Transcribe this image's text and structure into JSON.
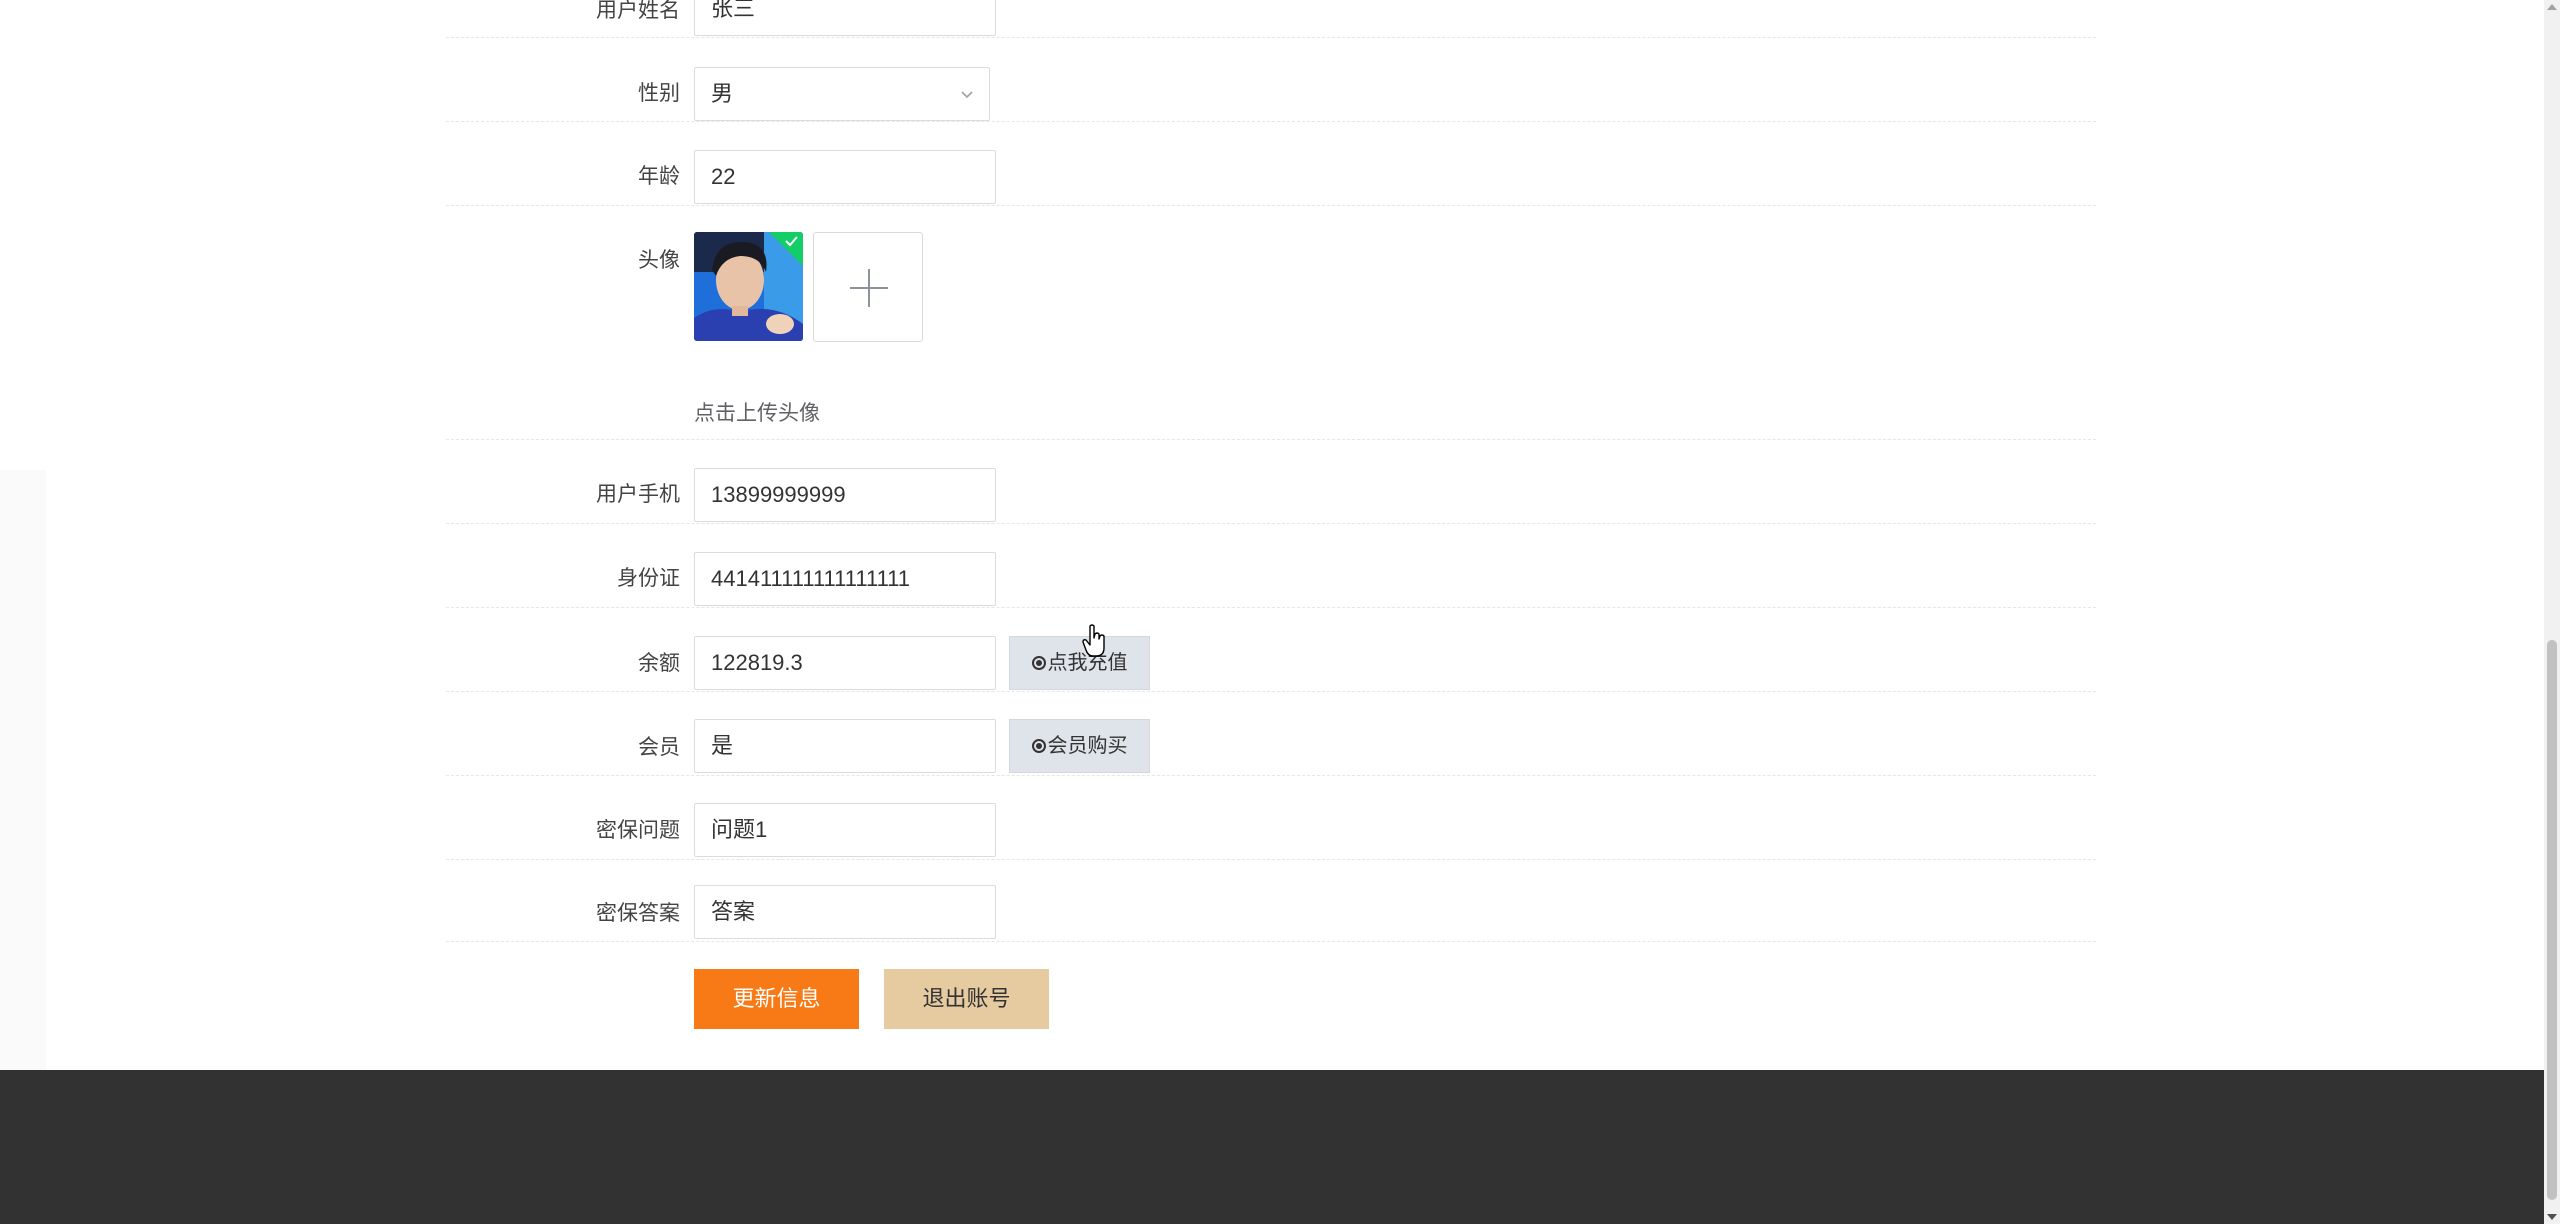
{
  "form": {
    "name": {
      "label": "用户姓名",
      "value": "张三"
    },
    "gender": {
      "label": "性别",
      "value": "男"
    },
    "age": {
      "label": "年龄",
      "value": "22"
    },
    "avatar": {
      "label": "头像",
      "hint": "点击上传头像"
    },
    "phone": {
      "label": "用户手机",
      "value": "13899999999"
    },
    "id_card": {
      "label": "身份证",
      "value": "441411111111111111"
    },
    "balance": {
      "label": "余额",
      "value": "122819.3",
      "button": "点我充值"
    },
    "member": {
      "label": "会员",
      "value": "是",
      "button": "会员购买"
    },
    "security_question": {
      "label": "密保问题",
      "value": "问题1"
    },
    "security_answer": {
      "label": "密保答案",
      "value": "答案"
    }
  },
  "actions": {
    "update": "更新信息",
    "logout": "退出账号"
  },
  "colors": {
    "primary": "#f77a16",
    "secondary": "#e6caa0",
    "footer": "#323232",
    "upload_success": "#13ce66"
  }
}
